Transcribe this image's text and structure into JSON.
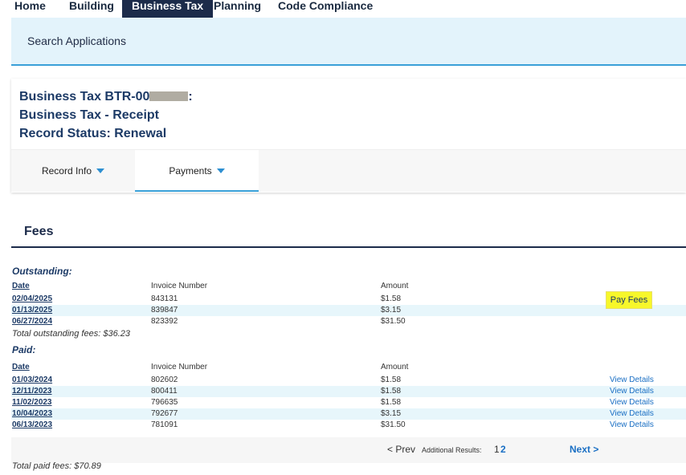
{
  "nav": [
    "Home",
    "Building",
    "Business Tax",
    "Planning",
    "Code Compliance"
  ],
  "search": {
    "label": "Search Applications"
  },
  "record": {
    "line1_prefix": "Business Tax BTR-00",
    "line1_suffix": ":",
    "line2": "Business Tax - Receipt",
    "line3": "Record Status: Renewal"
  },
  "tabs": {
    "record_info": "Record Info",
    "payments": "Payments"
  },
  "fees": {
    "title": "Fees",
    "outstanding": {
      "title": "Outstanding:",
      "headers": {
        "date": "Date",
        "invoice": "Invoice Number",
        "amount": "Amount"
      },
      "rows": [
        {
          "date": "02/04/2025",
          "invoice": "843131",
          "amount": "$1.58"
        },
        {
          "date": "01/13/2025",
          "invoice": "839847",
          "amount": "$3.15"
        },
        {
          "date": "06/27/2024",
          "invoice": "823392",
          "amount": "$31.50"
        }
      ],
      "pay_button": "Pay Fees",
      "total": "Total outstanding fees: $36.23"
    },
    "paid": {
      "title": "Paid:",
      "headers": {
        "date": "Date",
        "invoice": "Invoice Number",
        "amount": "Amount"
      },
      "rows": [
        {
          "date": "01/03/2024",
          "invoice": "802602",
          "amount": "$1.58",
          "link": "View Details"
        },
        {
          "date": "12/11/2023",
          "invoice": "800411",
          "amount": "$1.58",
          "link": "View Details"
        },
        {
          "date": "11/02/2023",
          "invoice": "796635",
          "amount": "$1.58",
          "link": "View Details"
        },
        {
          "date": "10/04/2023",
          "invoice": "792677",
          "amount": "$3.15",
          "link": "View Details"
        },
        {
          "date": "06/13/2023",
          "invoice": "781091",
          "amount": "$31.50",
          "link": "View Details"
        }
      ],
      "total": "Total paid fees: $70.89"
    },
    "pagination": {
      "prev": "< Prev",
      "additional_results": "Additional Results:",
      "pages": [
        "1",
        "2"
      ],
      "next": "Next >"
    }
  }
}
